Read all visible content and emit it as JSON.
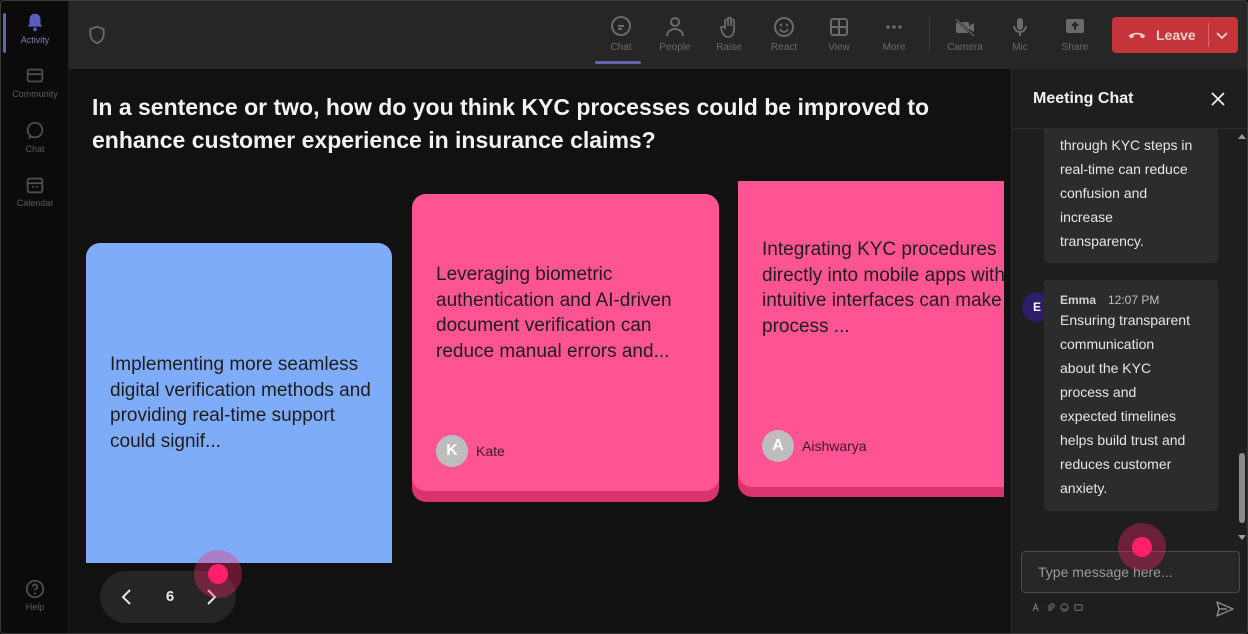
{
  "rail": {
    "items": [
      {
        "label": "Activity",
        "icon": "bell-icon"
      },
      {
        "label": "Community",
        "icon": "community-icon"
      },
      {
        "label": "Chat",
        "icon": "chat-icon"
      },
      {
        "label": "Calendar",
        "icon": "calendar-icon"
      },
      {
        "label": "Help",
        "icon": "help-icon"
      }
    ]
  },
  "toolbar": {
    "chat": "Chat",
    "people": "People",
    "raise": "Raise",
    "react": "React",
    "view": "View",
    "more": "More",
    "camera": "Camera",
    "mic": "Mic",
    "share": "Share",
    "leave": "Leave"
  },
  "question": "In a sentence or two, how do you think KYC processes could be improved to enhance customer experience in insurance claims?",
  "cards": [
    {
      "text": "Implementing more seamless digital verification methods and providing real-time support could signif...",
      "color": "#7facf9"
    },
    {
      "text": "Leveraging biometric authentication and AI-driven document verification can reduce manual errors and...",
      "author": "Kate",
      "initial": "K",
      "color": "#fe5494"
    },
    {
      "text": "Integrating KYC procedures directly into mobile apps with intuitive interfaces can make the process ...",
      "author": "Aishwarya",
      "initial": "A",
      "color": "#fe5494"
    }
  ],
  "pager": {
    "page": "6"
  },
  "chat": {
    "title": "Meeting Chat",
    "messages": [
      {
        "text_lines": [
          "through KYC steps in",
          "real-time can reduce",
          "confusion and",
          "increase",
          "transparency."
        ]
      },
      {
        "sender": "Emma",
        "initial": "E",
        "time": "12:07 PM",
        "text_lines": [
          "Ensuring transparent",
          "communication",
          "about the KYC",
          "process and",
          "expected timelines",
          "helps build trust and",
          "reduces customer",
          "anxiety."
        ]
      }
    ],
    "input_placeholder": "Type message here..."
  }
}
